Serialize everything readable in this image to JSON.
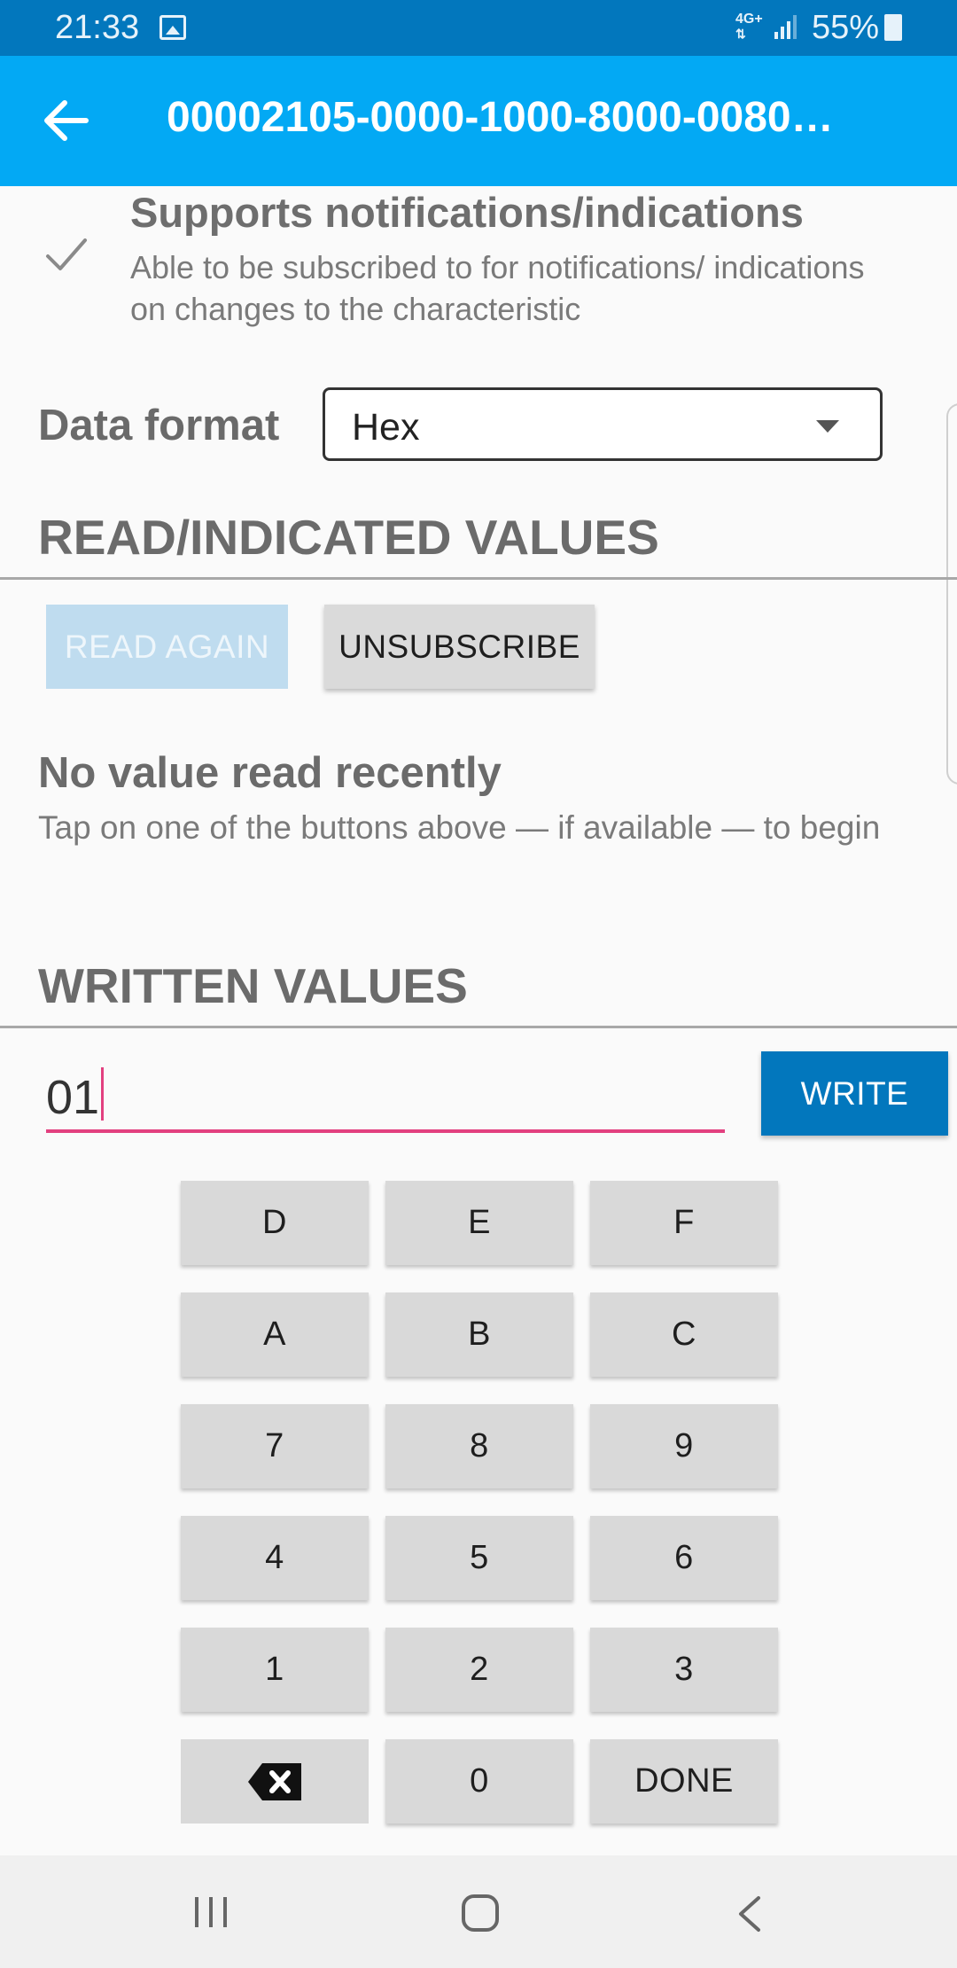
{
  "status_bar": {
    "time": "21:33",
    "gallery_icon": "image-icon",
    "network": "4G+",
    "battery_percent": "55%",
    "battery_level": 0.55
  },
  "app_bar": {
    "title": "00002105-0000-1000-8000-0080…",
    "back_icon": "arrow-left-icon"
  },
  "properties": {
    "notifications": {
      "icon": "check-icon",
      "title": "Supports notifications/indications",
      "description": "Able to be subscribed to for notifications/ indications on changes to the characteristic"
    }
  },
  "data_format": {
    "label": "Data format",
    "selected": "Hex"
  },
  "read_section": {
    "title": "READ/INDICATED VALUES",
    "read_again_label": "READ AGAIN",
    "read_again_enabled": false,
    "unsubscribe_label": "UNSUBSCRIBE",
    "empty_title": "No value read recently",
    "empty_desc": "Tap on one of the buttons above — if available — to begin"
  },
  "write_section": {
    "title": "WRITTEN VALUES",
    "input_value": "01",
    "write_label": "WRITE"
  },
  "keypad": {
    "keys": [
      [
        "D",
        "E",
        "F"
      ],
      [
        "A",
        "B",
        "C"
      ],
      [
        "7",
        "8",
        "9"
      ],
      [
        "4",
        "5",
        "6"
      ],
      [
        "1",
        "2",
        "3"
      ],
      [
        "backspace",
        "0",
        "DONE"
      ]
    ]
  },
  "colors": {
    "status_bar": "#0277bd",
    "app_bar": "#03a9f4",
    "accent": "#e2407f",
    "write_button": "#0277bd"
  }
}
